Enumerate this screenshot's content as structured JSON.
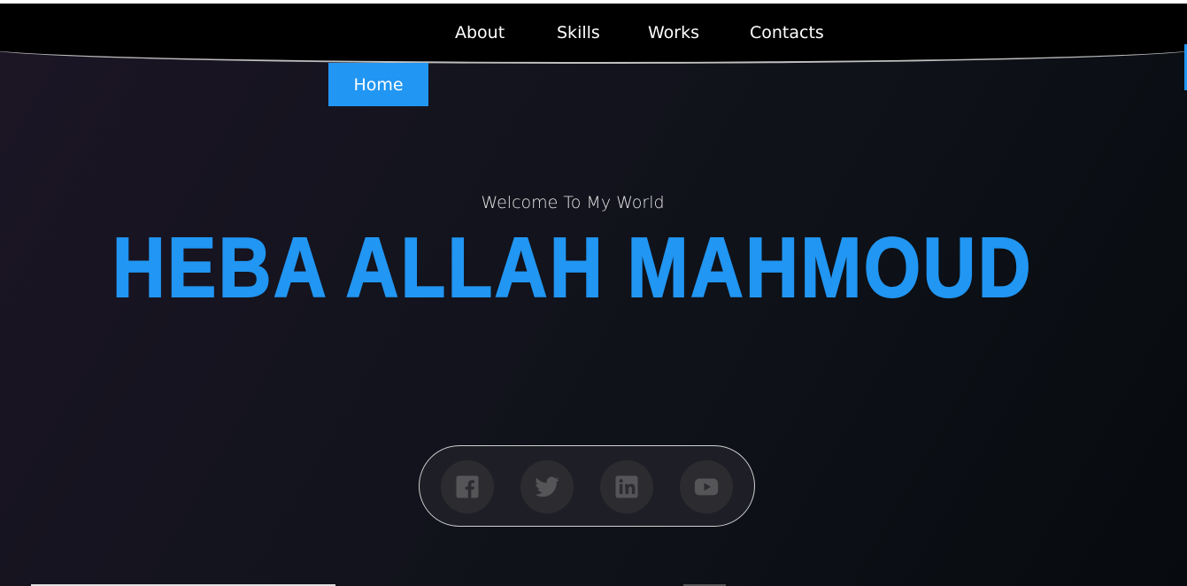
{
  "nav": {
    "items": [
      {
        "label": "About"
      },
      {
        "label": "Skills"
      },
      {
        "label": "Works"
      },
      {
        "label": "Contacts"
      }
    ],
    "home_label": "Home"
  },
  "hero": {
    "welcome": "Welcome To My World",
    "name": "HEBA ALLAH MAHMOUD"
  },
  "social": {
    "icons": [
      "facebook-icon",
      "twitter-icon",
      "linkedin-icon",
      "youtube-icon"
    ]
  },
  "colors": {
    "accent": "#2196f3",
    "navbar": "#000000",
    "background": "#15141f",
    "icon": "#555558"
  }
}
